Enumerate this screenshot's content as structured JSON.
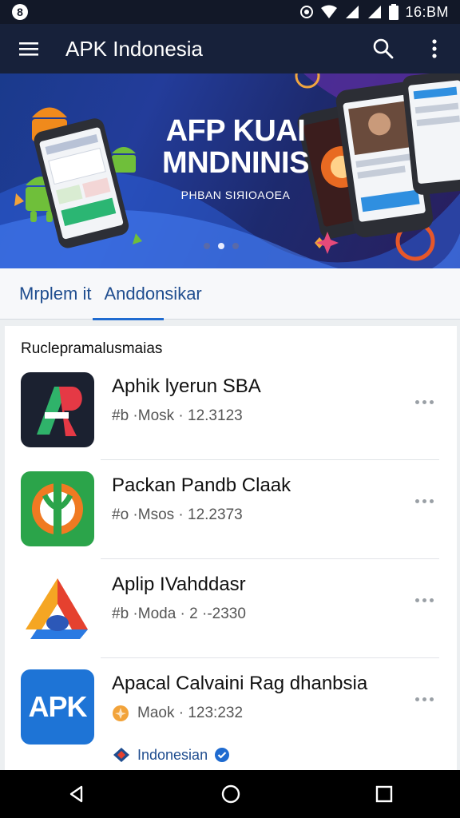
{
  "status_bar": {
    "time": "16:BM",
    "left_icon": "notification-badge-icon"
  },
  "app_bar": {
    "title": "APK Indonesia",
    "menu_icon": "hamburger-menu-icon",
    "search_icon": "search-icon",
    "overflow_icon": "more-vert-icon"
  },
  "banner": {
    "headline_line1": "AFP KUAI",
    "headline_line2": "MNDNINIS",
    "subtitle": "PHBAN SIЯIOAOEA",
    "active_slide": 2,
    "slide_count": 3
  },
  "tabs": [
    {
      "label": "Mrplem it"
    },
    {
      "label": "Anddonsikar"
    }
  ],
  "section": {
    "title": "Ruclepramalusmaias"
  },
  "apps": [
    {
      "name": "Aphik lyerun SBA",
      "meta": "#b ·Mosk · 12.3123"
    },
    {
      "name": "Packan Pandb Claak",
      "meta": "#o ·Msos · 12.2373"
    },
    {
      "name": "Aplip IVahddasr",
      "meta": "#b ·Moda · 2 ·-2330"
    },
    {
      "name": "Apacal Calvaini Rag dhanbsia",
      "meta": "Maok · 123:232",
      "icon_text": "APK",
      "publisher": "Indonesian"
    }
  ],
  "colors": {
    "accent": "#1f6bd0",
    "app_bar": "#17213a",
    "tab_text": "#1f4d8f"
  }
}
